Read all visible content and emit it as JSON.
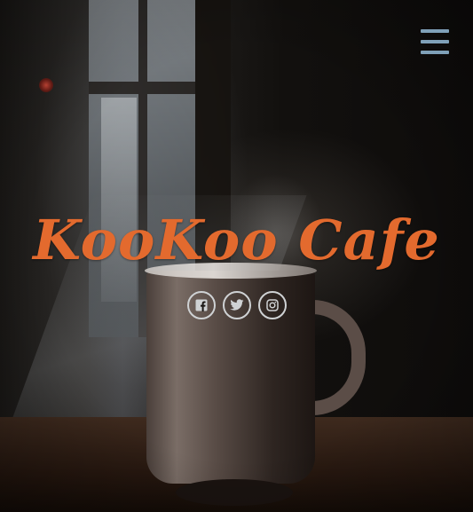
{
  "header": {
    "menu_icon": "hamburger-menu-icon",
    "menu_color": "#7fa0b8"
  },
  "hero": {
    "title": "KooKoo Cafe",
    "title_color": "#e36a2e",
    "background_image": "coffee-mug-photo"
  },
  "social": {
    "links": [
      {
        "icon": "facebook-icon",
        "network": "facebook"
      },
      {
        "icon": "twitter-icon",
        "network": "twitter"
      },
      {
        "icon": "instagram-icon",
        "network": "instagram"
      }
    ],
    "icon_color": "#cfd2d4"
  }
}
